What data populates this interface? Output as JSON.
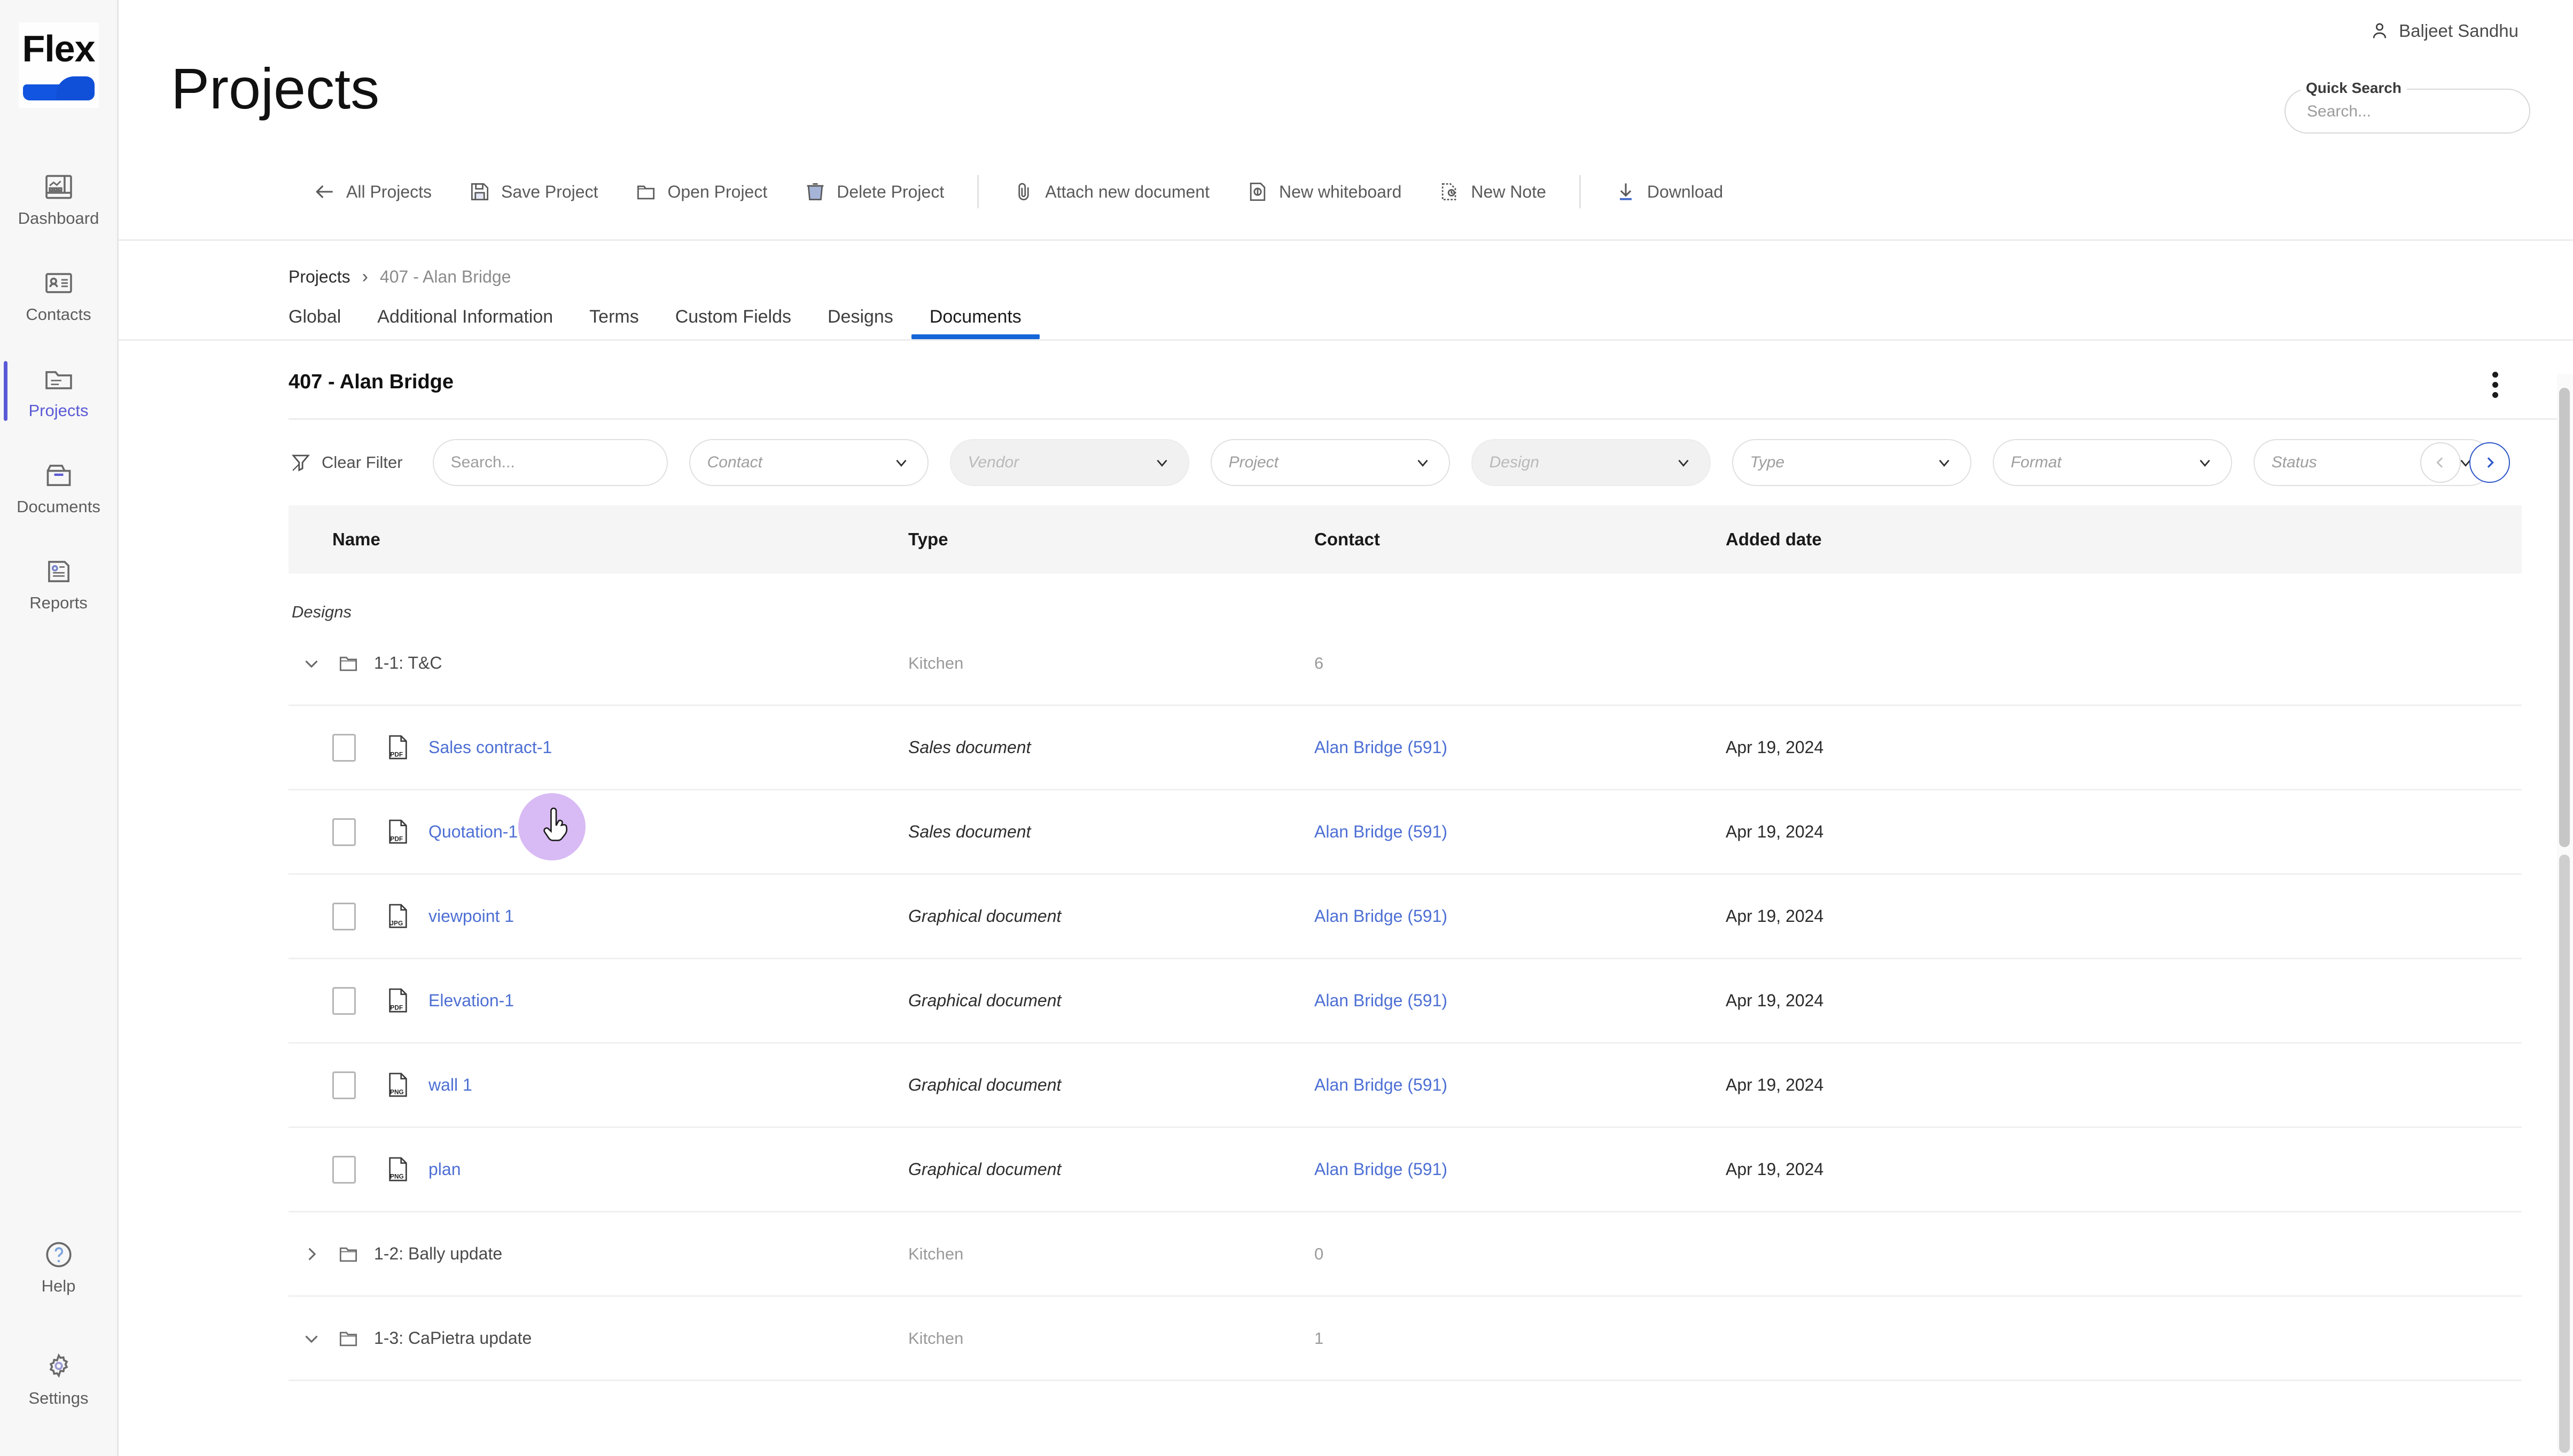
{
  "brand": {
    "name": "Flex",
    "logo_icon": "flex-logo"
  },
  "sidebar": {
    "items": [
      {
        "label": "Dashboard",
        "icon": "dashboard-icon",
        "active": false
      },
      {
        "label": "Contacts",
        "icon": "contacts-icon",
        "active": false
      },
      {
        "label": "Projects",
        "icon": "projects-folder-icon",
        "active": true
      },
      {
        "label": "Documents",
        "icon": "documents-icon",
        "active": false
      },
      {
        "label": "Reports",
        "icon": "reports-icon",
        "active": false
      }
    ],
    "bottom_items": [
      {
        "label": "Help",
        "icon": "help-circle-icon"
      },
      {
        "label": "Settings",
        "icon": "gear-icon"
      }
    ]
  },
  "header": {
    "title": "Projects",
    "user": {
      "name": "Baljeet Sandhu",
      "icon": "user-icon"
    },
    "quick_search": {
      "legend": "Quick Search",
      "placeholder": "Search...",
      "value": ""
    }
  },
  "toolbar": {
    "buttons": [
      {
        "label": "All Projects",
        "icon": "arrow-left-icon"
      },
      {
        "label": "Save Project",
        "icon": "save-disk-icon"
      },
      {
        "label": "Open Project",
        "icon": "folder-open-icon"
      },
      {
        "label": "Delete Project",
        "icon": "trash-icon"
      },
      {
        "label": "Attach new document",
        "icon": "paperclip-icon"
      },
      {
        "label": "New whiteboard",
        "icon": "whiteboard-icon"
      },
      {
        "label": "New Note",
        "icon": "note-icon"
      },
      {
        "label": "Download",
        "icon": "download-icon"
      }
    ]
  },
  "breadcrumb": {
    "root": "Projects",
    "separator": "›",
    "current": "407 - Alan Bridge"
  },
  "tabs": [
    {
      "label": "Global",
      "active": false
    },
    {
      "label": "Additional Information",
      "active": false
    },
    {
      "label": "Terms",
      "active": false
    },
    {
      "label": "Custom Fields",
      "active": false
    },
    {
      "label": "Designs",
      "active": false
    },
    {
      "label": "Documents",
      "active": true
    }
  ],
  "panel": {
    "title": "407 - Alan Bridge",
    "menu_icon": "kebab-menu-icon"
  },
  "filters": {
    "clear_label": "Clear Filter",
    "clear_icon": "filter-clear-icon",
    "search": {
      "placeholder": "Search...",
      "value": ""
    },
    "selects": [
      {
        "label": "Contact",
        "disabled": false
      },
      {
        "label": "Vendor",
        "disabled": true
      },
      {
        "label": "Project",
        "disabled": false
      },
      {
        "label": "Design",
        "disabled": true
      },
      {
        "label": "Type",
        "disabled": false
      },
      {
        "label": "Format",
        "disabled": false
      },
      {
        "label": "Status",
        "disabled": false
      }
    ],
    "pager": {
      "prev_icon": "chevron-left-icon",
      "next_icon": "chevron-right-icon",
      "next_active": true
    }
  },
  "table": {
    "columns": [
      "Name",
      "Type",
      "Contact",
      "Added date"
    ],
    "group_label": "Designs",
    "folders": [
      {
        "name": "1-1: T&C",
        "type": "Kitchen",
        "count": "6",
        "expanded": true
      },
      {
        "name": "1-2: Bally update",
        "type": "Kitchen",
        "count": "0",
        "expanded": false
      },
      {
        "name": "1-3: CaPietra update",
        "type": "Kitchen",
        "count": "1",
        "expanded": true
      }
    ],
    "rows": [
      {
        "name": "Sales contract-1",
        "file_icon": "pdf-file-icon",
        "type": "Sales document",
        "contact": "Alan Bridge (591)",
        "date": "Apr 19, 2024",
        "checked": false
      },
      {
        "name": "Quotation-1",
        "file_icon": "pdf-file-icon",
        "type": "Sales document",
        "contact": "Alan Bridge (591)",
        "date": "Apr 19, 2024",
        "checked": false
      },
      {
        "name": "viewpoint 1",
        "file_icon": "jpg-file-icon",
        "type": "Graphical document",
        "contact": "Alan Bridge (591)",
        "date": "Apr 19, 2024",
        "checked": false
      },
      {
        "name": "Elevation-1",
        "file_icon": "pdf-file-icon",
        "type": "Graphical document",
        "contact": "Alan Bridge (591)",
        "date": "Apr 19, 2024",
        "checked": false
      },
      {
        "name": "wall 1",
        "file_icon": "png-file-icon",
        "type": "Graphical document",
        "contact": "Alan Bridge (591)",
        "date": "Apr 19, 2024",
        "checked": false
      },
      {
        "name": "plan",
        "file_icon": "png-file-icon",
        "type": "Graphical document",
        "contact": "Alan Bridge (591)",
        "date": "Apr 19, 2024",
        "checked": false
      }
    ]
  },
  "colors": {
    "accent_blue": "#1565d8",
    "link_blue": "#4d6fd4",
    "sidebar_active": "#5b5ad6",
    "brand_blue": "#1155e0",
    "cursor_halo": "#c9a0f0"
  }
}
